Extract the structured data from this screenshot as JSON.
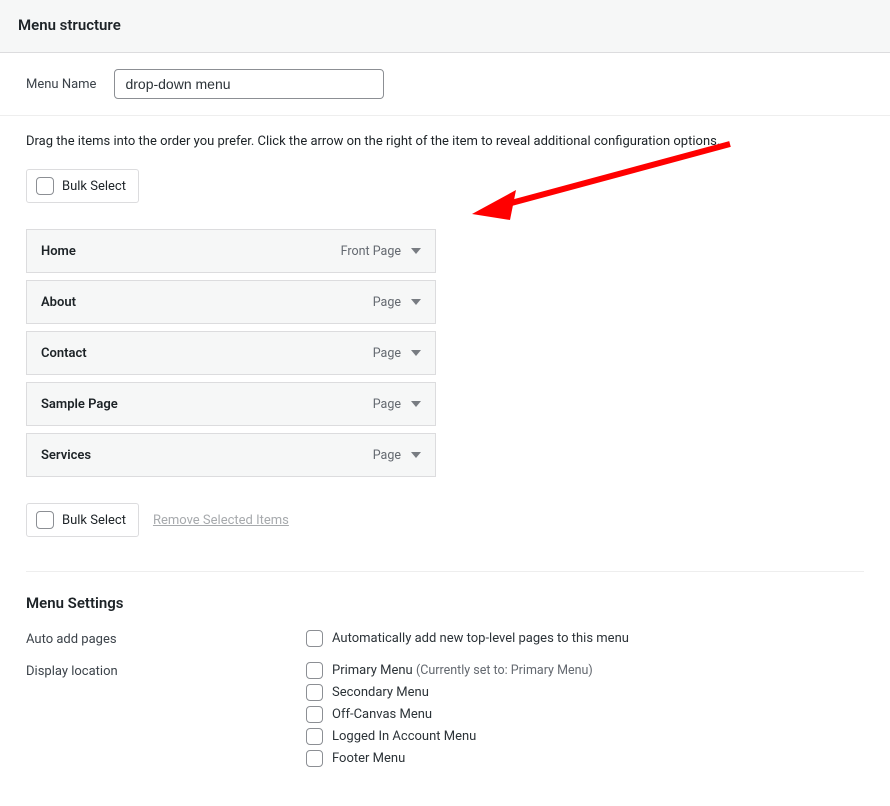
{
  "header": {
    "title": "Menu structure"
  },
  "menuName": {
    "label": "Menu Name",
    "value": "drop-down menu"
  },
  "instructions": "Drag the items into the order you prefer. Click the arrow on the right of the item to reveal additional configuration options.",
  "bulkSelect": {
    "label": "Bulk Select"
  },
  "items": [
    {
      "title": "Home",
      "type": "Front Page"
    },
    {
      "title": "About",
      "type": "Page"
    },
    {
      "title": "Contact",
      "type": "Page"
    },
    {
      "title": "Sample Page",
      "type": "Page"
    },
    {
      "title": "Services",
      "type": "Page"
    }
  ],
  "removeSelected": "Remove Selected Items",
  "settings": {
    "heading": "Menu Settings",
    "autoAdd": {
      "label": "Auto add pages",
      "option": "Automatically add new top-level pages to this menu"
    },
    "displayLoc": {
      "label": "Display location",
      "options": [
        {
          "text": "Primary Menu",
          "note": "(Currently set to: Primary Menu)"
        },
        {
          "text": "Secondary Menu",
          "note": ""
        },
        {
          "text": "Off-Canvas Menu",
          "note": ""
        },
        {
          "text": "Logged In Account Menu",
          "note": ""
        },
        {
          "text": "Footer Menu",
          "note": ""
        }
      ]
    }
  }
}
